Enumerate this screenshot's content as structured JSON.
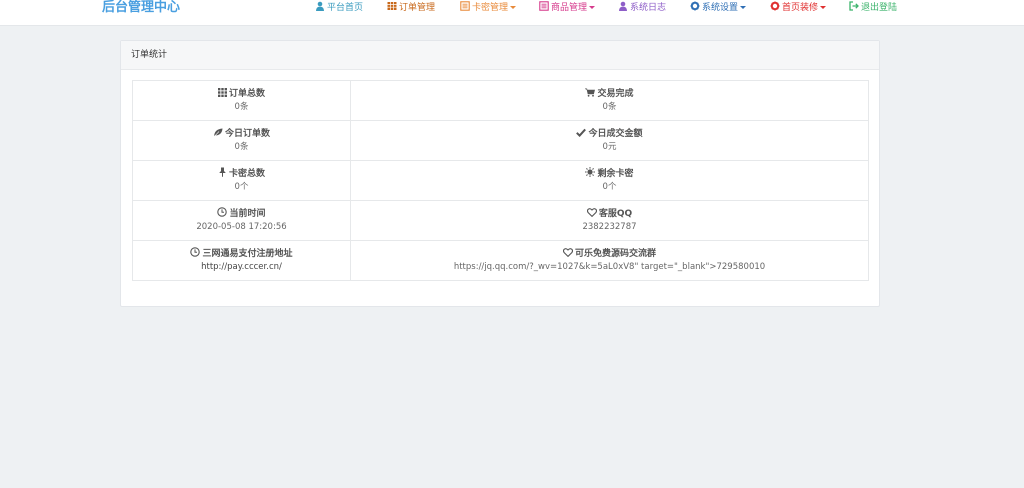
{
  "header": {
    "brand": "后台管理中心",
    "nav": [
      {
        "label": "平台首页",
        "icon": "user-icon",
        "color": "#3a9bbf",
        "dropdown": false
      },
      {
        "label": "订单管理",
        "icon": "table-icon",
        "color": "#c8691c",
        "dropdown": false
      },
      {
        "label": "卡密管理",
        "icon": "list-alt-icon",
        "color": "#e88a3a",
        "dropdown": true
      },
      {
        "label": "商品管理",
        "icon": "list-alt-icon",
        "color": "#d63a8c",
        "dropdown": true
      },
      {
        "label": "系统日志",
        "icon": "user-icon",
        "color": "#8e5ec8",
        "dropdown": false
      },
      {
        "label": "系统设置",
        "icon": "gear-icon",
        "color": "#2f6fb5",
        "dropdown": true
      },
      {
        "label": "首页装修",
        "icon": "gear-icon",
        "color": "#e03030",
        "dropdown": true
      },
      {
        "label": "退出登陆",
        "icon": "logout-icon",
        "color": "#3bb36b",
        "dropdown": false
      }
    ]
  },
  "panel": {
    "title": "订单统计",
    "rows": [
      [
        {
          "label": "订单总数",
          "value": "0条",
          "icon": "grid-icon"
        },
        {
          "label": "交易完成",
          "value": "0条",
          "icon": "cart-icon"
        }
      ],
      [
        {
          "label": "今日订单数",
          "value": "0条",
          "icon": "leaf-icon"
        },
        {
          "label": "今日成交金额",
          "value": "0元",
          "icon": "check-icon"
        }
      ],
      [
        {
          "label": "卡密总数",
          "value": "0个",
          "icon": "pushpin-icon"
        },
        {
          "label": "剩余卡密",
          "value": "0个",
          "icon": "sun-icon"
        }
      ],
      [
        {
          "label": "当前时间",
          "value": "2020-05-08 17:20:56",
          "icon": "clock-icon"
        },
        {
          "label": "客服QQ",
          "value": "2382232787",
          "icon": "heart-icon"
        }
      ],
      [
        {
          "label": "三网通易支付注册地址",
          "value": "http://pay.cccer.cn/",
          "icon": "clock-icon"
        },
        {
          "label": "可乐免费源码交流群",
          "value": "https://jq.qq.com/?_wv=1027&k=5aL0xV8\" target=\"_blank\">729580010",
          "icon": "heart-icon"
        }
      ]
    ]
  }
}
